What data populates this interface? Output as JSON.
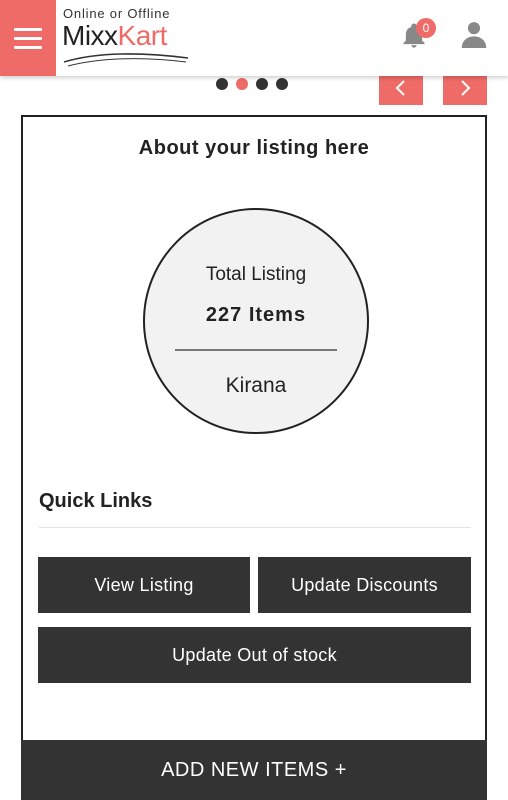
{
  "header": {
    "logo_tagline": "Online or Offline",
    "logo_brand_part1": "Mixx",
    "logo_brand_part2": "Kart",
    "notification_count": "0",
    "accent_color": "#ef6b67"
  },
  "carousel": {
    "dot_count": 4,
    "active_index": 1
  },
  "listing": {
    "title": "About your listing here",
    "total_label": "Total Listing",
    "total_value": "227 Items",
    "category": "Kirana"
  },
  "quick_links": {
    "title": "Quick Links",
    "view_listing": "View Listing",
    "update_discounts": "Update Discounts",
    "update_out_of_stock": "Update Out of stock"
  },
  "footer": {
    "add_new_items": "ADD NEW ITEMS +"
  },
  "icons": [
    "menu-icon",
    "bell-icon",
    "user-icon",
    "chevron-left-icon",
    "chevron-right-icon"
  ]
}
